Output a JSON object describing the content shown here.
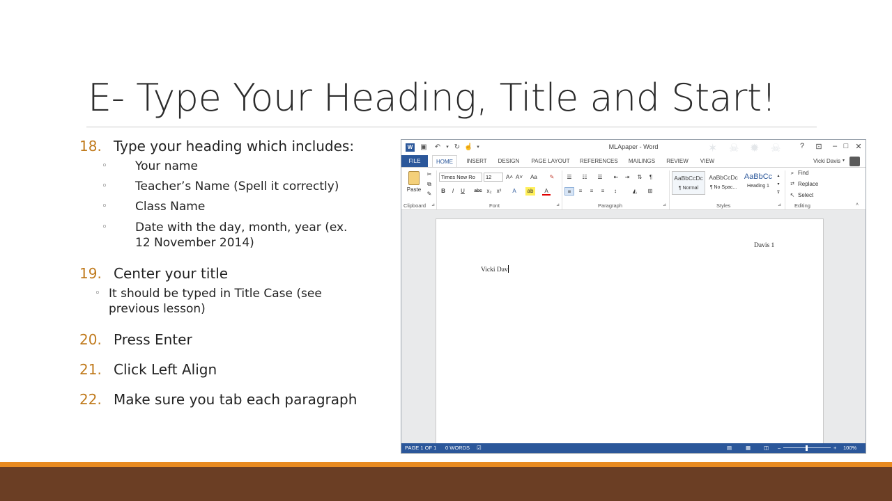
{
  "slide": {
    "title": "E- Type Your Heading, Title and Start!",
    "steps": [
      {
        "num": "18.",
        "text": "Type your heading which includes:",
        "subs": [
          {
            "bullet": "◦",
            "lines": [
              "Your name"
            ]
          },
          {
            "bullet": "◦",
            "lines": [
              "Teacher’s Name (Spell it correctly)"
            ]
          },
          {
            "bullet": "◦",
            "lines": [
              "Class Name"
            ]
          },
          {
            "bullet": "◦",
            "lines": [
              "Date with the day, month, year (ex.",
              "12 November 2014)"
            ]
          }
        ]
      },
      {
        "num": "19.",
        "text": "Center your title",
        "subs": [
          {
            "bullet": "◦",
            "lines": [
              "It should be typed in Title Case (see",
              "previous lesson)"
            ]
          }
        ]
      },
      {
        "num": "20.",
        "text": "Press Enter"
      },
      {
        "num": "21.",
        "text": "Click Left Align"
      },
      {
        "num": "22.",
        "text": "Make sure you tab each paragraph"
      }
    ]
  },
  "word": {
    "window_title": "MLApaper - Word",
    "controls": {
      "help": "?",
      "ribbon_options": "⊡",
      "minimize": "–",
      "maximize": "□",
      "close": "✕"
    },
    "tabs": [
      "FILE",
      "HOME",
      "INSERT",
      "DESIGN",
      "PAGE LAYOUT",
      "REFERENCES",
      "MAILINGS",
      "REVIEW",
      "VIEW"
    ],
    "active_tab": "HOME",
    "user": "Vicki Davis",
    "ribbon": {
      "clipboard": {
        "paste_label": "Paste",
        "group_label": "Clipboard"
      },
      "font": {
        "font_name": "Times New Ro",
        "font_size": "12",
        "grow": "A˄",
        "shrink": "A˅",
        "case": "Aa",
        "clear": "✎",
        "bold": "B",
        "italic": "I",
        "underline": "U",
        "strike": "abc",
        "subscript": "x₂",
        "superscript": "x²",
        "effects": "A",
        "highlight": "ab",
        "color": "A",
        "group_label": "Font"
      },
      "paragraph": {
        "pilcrow": "¶",
        "group_label": "Paragraph"
      },
      "styles": {
        "items": [
          {
            "preview": "AaBbCcDc",
            "name": "¶ Normal"
          },
          {
            "preview": "AaBbCcDc",
            "name": "¶ No Spac..."
          },
          {
            "preview": "AaBbCc",
            "name": "Heading 1"
          }
        ],
        "group_label": "Styles"
      },
      "editing": {
        "find": "Find",
        "replace": "Replace",
        "select": "Select",
        "group_label": "Editing"
      }
    },
    "document": {
      "header": "Davis 1",
      "body_text": "Vicki Dav"
    },
    "status": {
      "page": "PAGE 1 OF 1",
      "words": "0 WORDS",
      "zoom": "100%"
    },
    "colors": {
      "accent": "#2b579a"
    }
  },
  "footer": {
    "colors": {
      "orange": "#e88a20",
      "brown": "#6b3e24"
    }
  }
}
